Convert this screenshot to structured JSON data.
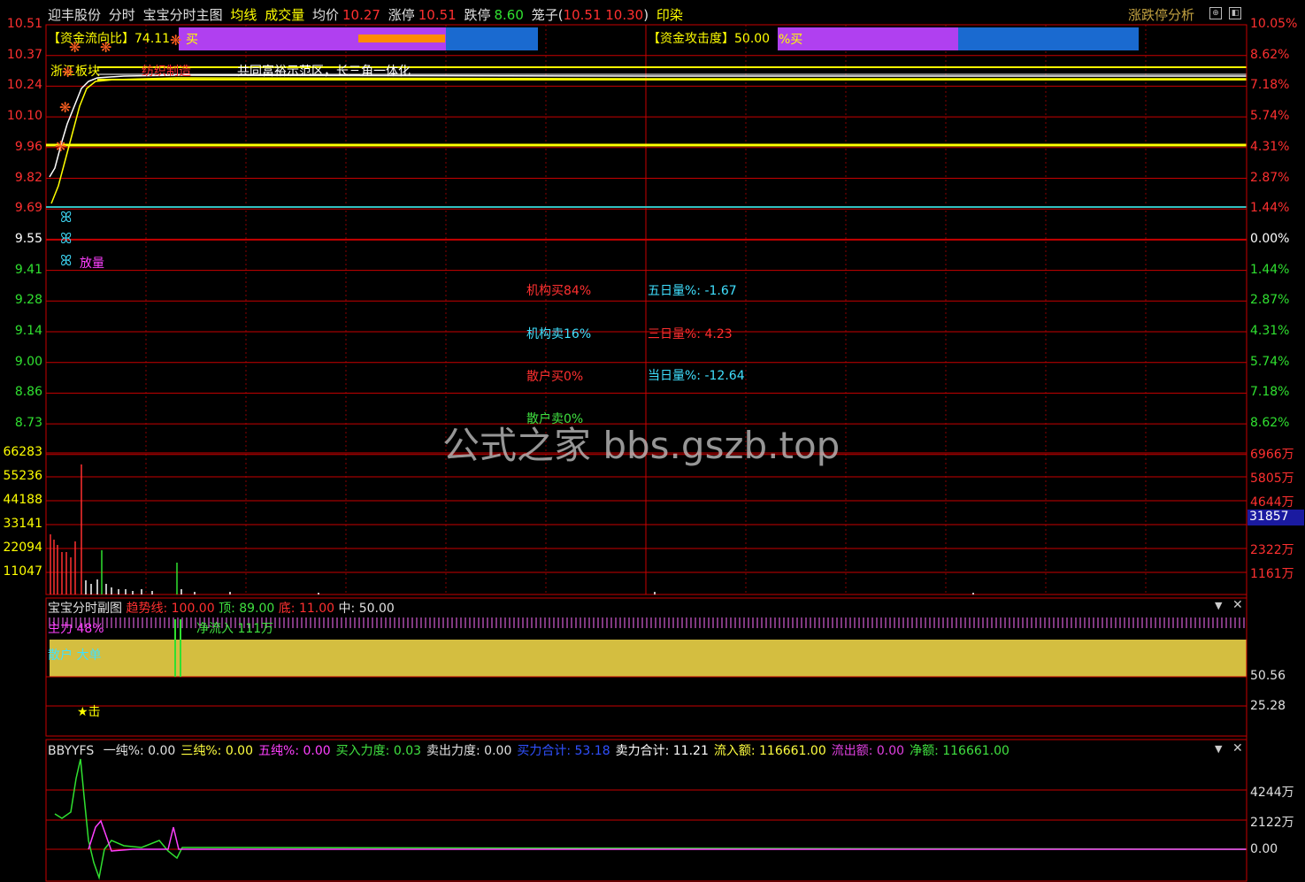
{
  "header": {
    "stock_name": "迎丰股份",
    "mode": "分时",
    "main_chart": "宝宝分时主图",
    "ma_label": "均线",
    "vol_label": "成交量",
    "avg_label": "均价",
    "avg_value": "10.27",
    "limit_up_label": "涨停",
    "limit_up_value": "10.51",
    "limit_down_label": "跌停",
    "limit_down_value": "8.60",
    "cage_label": "笼子(",
    "cage_value": "10.51  10.30",
    "cage_close": ")",
    "sector": "印染",
    "right_button": "涨跌停分析"
  },
  "price_axis_left": [
    "10.51",
    "10.37",
    "10.24",
    "10.10",
    "9.96",
    "9.82",
    "9.69",
    "9.55",
    "9.41",
    "9.28",
    "9.14",
    "9.00",
    "8.86",
    "8.73"
  ],
  "price_axis_right": [
    "10.05%",
    "8.62%",
    "7.18%",
    "5.74%",
    "4.31%",
    "2.87%",
    "1.44%",
    "0.00%",
    "1.44%",
    "2.87%",
    "4.31%",
    "5.74%",
    "7.18%",
    "8.62%"
  ],
  "volume_axis_left": [
    "66283",
    "55236",
    "44188",
    "33141",
    "22094",
    "11047"
  ],
  "volume_axis_right": [
    "6966万",
    "5805万",
    "4644万",
    "",
    "2322万",
    "1161万"
  ],
  "volume_current": "31857",
  "main_overlay": {
    "fund_flow_label": "【资金流向比】",
    "fund_flow_value": "74.11",
    "fund_flow_suffix": "买",
    "attack_label": "【资金攻击度】",
    "attack_value": "50.00",
    "attack_suffix": "%买",
    "board_tag": "浙江板块",
    "industry_tag": "纺织制造",
    "concept_tag": "共同富裕示范区，长三角一体化",
    "buterfly_label": "放量",
    "inst_buy": "机构买84%",
    "inst_sell": "机构卖16%",
    "retail_buy": "散户买0%",
    "retail_sell": "散户卖0%",
    "five_day": "五日量%: -1.67",
    "three_day": "三日量%: 4.23",
    "today": "当日量%: -12.64"
  },
  "watermark": "公式之家 bbs.gszb.top",
  "sub_chart1": {
    "title": "宝宝分时副图",
    "trend_label": "趋势线",
    "trend_value": "100.00",
    "top_label": "顶",
    "top_value": "89.00",
    "bottom_label": "底",
    "bottom_value": "11.00",
    "mid_label": "中",
    "mid_value": "50.00",
    "main_tag": "主力 48%",
    "net_inflow": "净流入 111万",
    "retail_tag": "散户 大单",
    "star_tag": "★击",
    "axis": [
      "50.56",
      "25.28"
    ]
  },
  "sub_chart2": {
    "title": "BBYYFS",
    "items": [
      {
        "label": "一纯%",
        "value": "0.00",
        "color": "#e0e0e0"
      },
      {
        "label": "三纯%",
        "value": "0.00",
        "color": "#ffff40"
      },
      {
        "label": "五纯%",
        "value": "0.00",
        "color": "#ff40ff"
      },
      {
        "label": "买入力度",
        "value": "0.03",
        "color": "#40e040"
      },
      {
        "label": "卖出力度",
        "value": "0.00",
        "color": "#e0e0e0"
      },
      {
        "label": "买力合计",
        "value": "53.18",
        "color": "#3050ff"
      },
      {
        "label": "卖力合计",
        "value": "11.21",
        "color": "#ffffff"
      },
      {
        "label": "流入额",
        "value": "116661.00",
        "color": "#ffff40"
      },
      {
        "label": "流出额",
        "value": "0.00",
        "color": "#e040e0"
      },
      {
        "label": "净额",
        "value": "116661.00",
        "color": "#40e040"
      }
    ],
    "axis": [
      "4244万",
      "2122万",
      "0.00"
    ]
  },
  "colors": {
    "grid": "#c80000",
    "up": "#ff3030",
    "down": "#30e030",
    "yellow": "#ffff00",
    "cyan": "#30c0c0"
  }
}
